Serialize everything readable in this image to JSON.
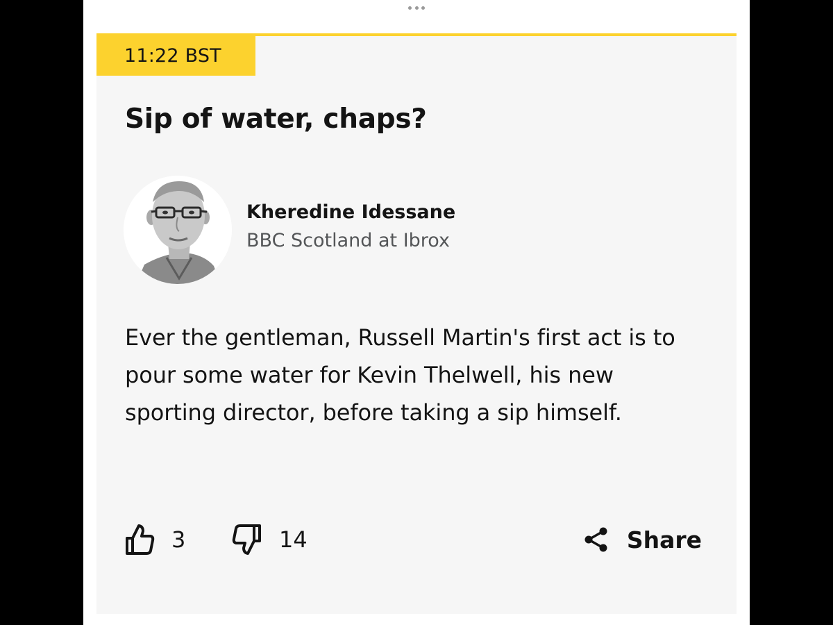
{
  "entry": {
    "timestamp": "11:22 BST",
    "headline": "Sip of water, chaps?",
    "author": {
      "name": "Kheredine Idessane",
      "role": "BBC Scotland at Ibrox"
    },
    "body": "Ever the gentleman, Russell Martin's first act is to pour some water for Kevin Thelwell, his new sporting director, before taking a sip himself."
  },
  "reactions": {
    "likes": "3",
    "dislikes": "14",
    "share_label": "Share"
  },
  "icons": {
    "more": "more-horizontal-icon",
    "like": "thumbs-up-icon",
    "dislike": "thumbs-down-icon",
    "share": "share-icon"
  },
  "colors": {
    "accent": "#fcd22e",
    "card_background": "#f6f6f6",
    "text": "#141414",
    "secondary_text": "#545658"
  }
}
